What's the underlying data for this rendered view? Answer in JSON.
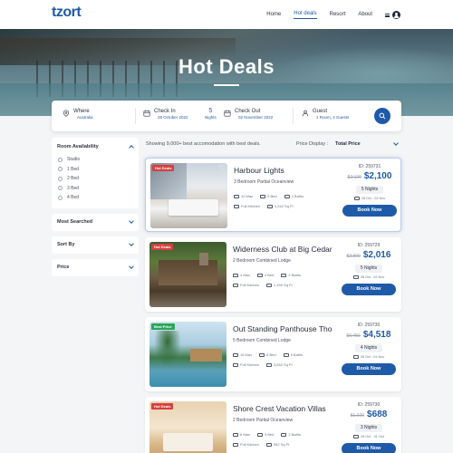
{
  "brand": {
    "logo": "tzort",
    "tagline": ""
  },
  "nav": {
    "items": [
      "Home",
      "Hot deals",
      "Resort",
      "About"
    ],
    "active": "Hot deals"
  },
  "hero": {
    "title": "Hot Deals"
  },
  "search": {
    "where": {
      "label": "Where",
      "value": "Australia"
    },
    "checkin": {
      "label": "Check In",
      "value": "28 October 2022"
    },
    "nights": {
      "value": "5",
      "label": "Nights"
    },
    "checkout": {
      "label": "Check Out",
      "value": "02 November 2022"
    },
    "guest": {
      "label": "Guest",
      "value": "1 Room, 4 Guests"
    }
  },
  "sidebar": {
    "room_availability": {
      "title": "Room Availability",
      "options": [
        "Studio",
        "1 Bed",
        "2 Bed",
        "3 Bed",
        "4 Bed"
      ]
    },
    "most_searched": "Most Searched",
    "sort_by": "Sort By",
    "price": "Price"
  },
  "results": {
    "count_text": "Showing 9,000+ best accomodation with best deals.",
    "price_display_label": "Price Display :",
    "price_display_value": "Total Price"
  },
  "cards": [
    {
      "tag": "Hot Deals",
      "title": "Harbour Lights",
      "subtitle": "3 Bedroom Partial Oceanview",
      "guests": "10 Max",
      "beds": "5 Bed",
      "baths": "2 Baths",
      "kitchen": "Full Kitchen",
      "area": "1,242 Sq Ft",
      "id": "ID: 259731",
      "old_price": "$2,120",
      "price": "$2,100",
      "nights": "5 Nights",
      "dates": "28 Oct - 02 Nov",
      "book": "Book Now"
    },
    {
      "tag": "Hot Deals",
      "title": "Widerness Club at Big Cedar",
      "subtitle": "2 Bedroom Combined Lodge",
      "guests": "4 Max",
      "beds": "4 Bed",
      "baths": "2 Baths",
      "kitchen": "Full Kitchen",
      "area": "1,150 Sq Ft",
      "id": "ID: 259729",
      "old_price": "$2,300",
      "price": "$2,016",
      "nights": "5 Nights",
      "dates": "28 Oct - 02 Nov",
      "book": "Book Now"
    },
    {
      "tag": "Best Price",
      "title": "Out Standing Panthouse Tho",
      "subtitle": "5 Bedroom Combined Lodge",
      "guests": "16 Max",
      "beds": "8 Bed",
      "baths": "5 Baths",
      "kitchen": "Full Kitchen",
      "area": "3,652 Sq Ft",
      "id": "ID: 259730",
      "old_price": "$6,459",
      "price": "$4,518",
      "nights": "4 Nights",
      "dates": "28 Oct - 01 Nov",
      "book": "Book Now"
    },
    {
      "tag": "Hot Deals",
      "title": "Shore Crest Vacation Villas",
      "subtitle": "2 Bedroom Partial Oceanview",
      "guests": "6 Max",
      "beds": "3 Bed",
      "baths": "2 Baths",
      "kitchen": "Full Kitchen",
      "area": "952 Sq Ft",
      "id": "ID: 259730",
      "old_price": "$1,020",
      "price": "$688",
      "nights": "3 Nights",
      "dates": "28 Oct - 31 Oct",
      "book": "Book Now"
    }
  ]
}
